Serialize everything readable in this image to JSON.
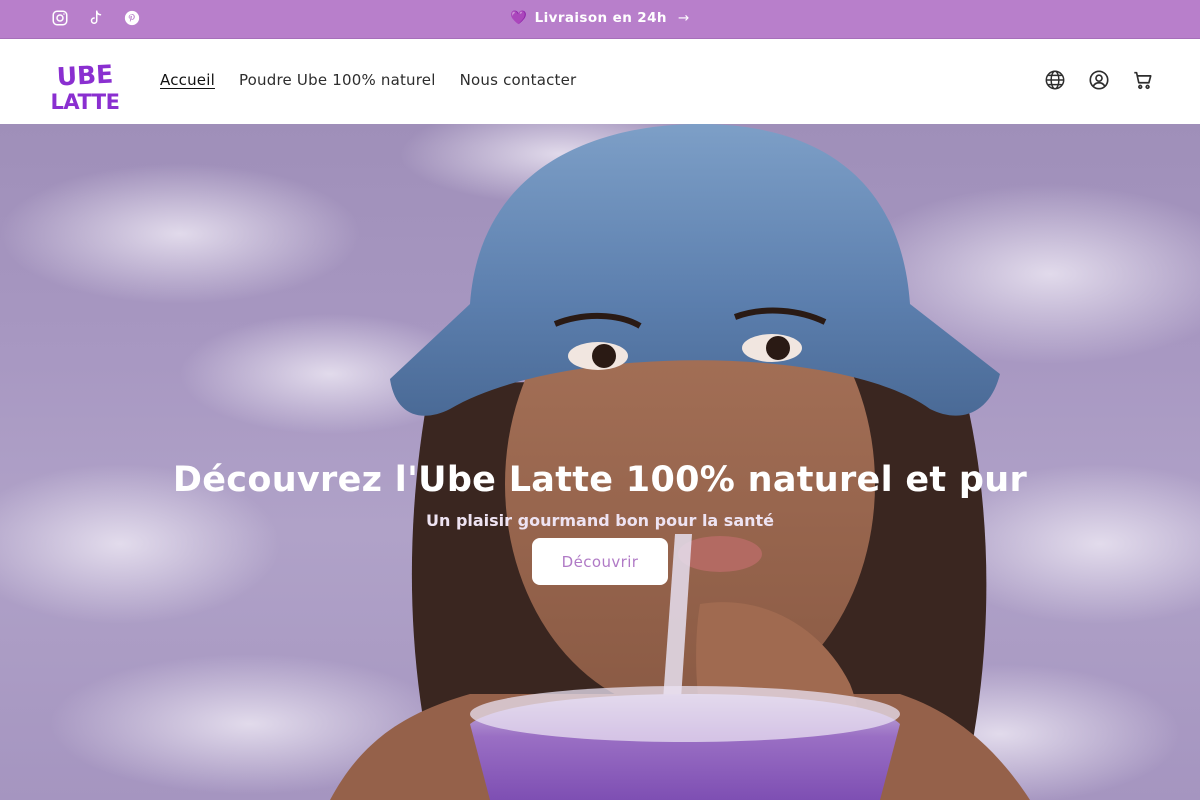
{
  "announcement": {
    "heart": "💜",
    "text": "Livraison en 24h",
    "arrow": "→"
  },
  "socials": [
    {
      "name": "instagram-icon"
    },
    {
      "name": "tiktok-icon"
    },
    {
      "name": "pinterest-icon"
    }
  ],
  "logo": {
    "line1": "UBE",
    "line2": "LATTE",
    "color": "#8a2fd0"
  },
  "nav": {
    "items": [
      {
        "label": "Accueil",
        "active": true
      },
      {
        "label": "Poudre Ube 100% naturel",
        "active": false
      },
      {
        "label": "Nous contacter",
        "active": false
      }
    ]
  },
  "header_icons": [
    "globe-icon",
    "account-icon",
    "cart-icon"
  ],
  "hero": {
    "title": "Découvrez l'Ube Latte 100% naturel et pur",
    "subtitle": "Un plaisir gourmand bon pour la santé",
    "button_label": "Découvrir"
  },
  "colors": {
    "announcement_bg": "#b87fcb",
    "accent": "#b07ac6",
    "brand_purple": "#8a2fd0"
  }
}
